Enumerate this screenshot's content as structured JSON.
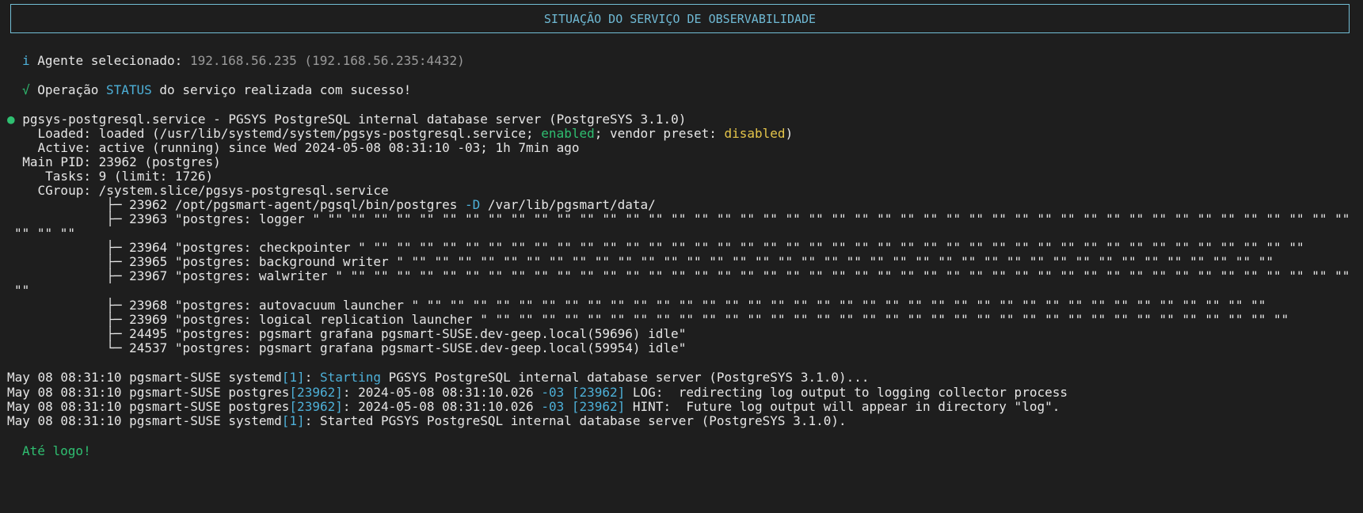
{
  "header": {
    "title": "SITUAÇÃO DO SERVIÇO DE OBSERVABILIDADE"
  },
  "agent": {
    "icon": "i",
    "label": "Agente selecionado: ",
    "value": "192.168.56.235 (192.168.56.235:4432)"
  },
  "operation": {
    "icon": "√",
    "prefix": "Operação ",
    "keyword": "STATUS",
    "suffix": " do serviço realizada com sucesso!"
  },
  "service": {
    "bullet": "●",
    "title": "pgsys-postgresql.service - PGSYS PostgreSQL internal database server (PostgreSYS 3.1.0)",
    "loaded_prefix": "    Loaded: loaded (/usr/lib/systemd/system/pgsys-postgresql.service; ",
    "loaded_enabled": "enabled",
    "loaded_mid": "; vendor preset: ",
    "loaded_disabled": "disabled",
    "loaded_suffix": ")",
    "active": "    Active: active (running) since Wed 2024-05-08 08:31:10 -03; 1h 7min ago",
    "main_pid": "  Main PID: 23962 (postgres)",
    "tasks": "     Tasks: 9 (limit: 1726)",
    "cgroup": "    CGroup: /system.slice/pgsys-postgresql.service",
    "proc1_prefix": "             ├─ 23962 /opt/pgsmart-agent/pgsql/bin/postgres ",
    "proc1_flag": "-D",
    "proc1_suffix": " /var/lib/pgsmart/data/",
    "proc2": "             ├─ 23963 \"postgres: logger \" \"\" \"\" \"\" \"\" \"\" \"\" \"\" \"\" \"\" \"\" \"\" \"\" \"\" \"\" \"\" \"\" \"\" \"\" \"\" \"\" \"\" \"\" \"\" \"\" \"\" \"\" \"\" \"\" \"\" \"\" \"\" \"\" \"\" \"\" \"\" \"\" \"\" \"\" \"\" \"\" \"\" \"\" \"\" \"\" \"\"",
    "proc2_wrap": "\"\" \"\" \"\"",
    "proc3": "             ├─ 23964 \"postgres: checkpointer \" \"\" \"\" \"\" \"\" \"\" \"\" \"\" \"\" \"\" \"\" \"\" \"\" \"\" \"\" \"\" \"\" \"\" \"\" \"\" \"\" \"\" \"\" \"\" \"\" \"\" \"\" \"\" \"\" \"\" \"\" \"\" \"\" \"\" \"\" \"\" \"\" \"\" \"\" \"\" \"\" \"\"",
    "proc4": "             ├─ 23965 \"postgres: background writer \" \"\" \"\" \"\" \"\" \"\" \"\" \"\" \"\" \"\" \"\" \"\" \"\" \"\" \"\" \"\" \"\" \"\" \"\" \"\" \"\" \"\" \"\" \"\" \"\" \"\" \"\" \"\" \"\" \"\" \"\" \"\" \"\" \"\" \"\" \"\" \"\" \"\" \"\"",
    "proc5": "             ├─ 23967 \"postgres: walwriter \" \"\" \"\" \"\" \"\" \"\" \"\" \"\" \"\" \"\" \"\" \"\" \"\" \"\" \"\" \"\" \"\" \"\" \"\" \"\" \"\" \"\" \"\" \"\" \"\" \"\" \"\" \"\" \"\" \"\" \"\" \"\" \"\" \"\" \"\" \"\" \"\" \"\" \"\" \"\" \"\" \"\" \"\" \"\" \"\"",
    "proc5_wrap": "\"\"",
    "proc6": "             ├─ 23968 \"postgres: autovacuum launcher \" \"\" \"\" \"\" \"\" \"\" \"\" \"\" \"\" \"\" \"\" \"\" \"\" \"\" \"\" \"\" \"\" \"\" \"\" \"\" \"\" \"\" \"\" \"\" \"\" \"\" \"\" \"\" \"\" \"\" \"\" \"\" \"\" \"\" \"\" \"\" \"\" \"\"",
    "proc7": "             ├─ 23969 \"postgres: logical replication launcher \" \"\" \"\" \"\" \"\" \"\" \"\" \"\" \"\" \"\" \"\" \"\" \"\" \"\" \"\" \"\" \"\" \"\" \"\" \"\" \"\" \"\" \"\" \"\" \"\" \"\" \"\" \"\" \"\" \"\" \"\" \"\" \"\" \"\" \"\" \"\"",
    "proc8": "             ├─ 24495 \"postgres: pgsmart grafana pgsmart-SUSE.dev-geep.local(59696) idle\"",
    "proc9": "             └─ 24537 \"postgres: pgsmart grafana pgsmart-SUSE.dev-geep.local(59954) idle\""
  },
  "logs": [
    {
      "prefix": "May 08 08:31:10 pgsmart-SUSE systemd",
      "pid": "[1]",
      "mid": ": ",
      "keyword": "Starting",
      "message": " PGSYS PostgreSQL internal database server (PostgreSYS 3.1.0)..."
    },
    {
      "prefix": "May 08 08:31:10 pgsmart-SUSE postgres",
      "pid": "[23962]",
      "mid": ": 2024-05-08 08:31:10.026 ",
      "tz": "-03",
      "pid2": " [23962]",
      "message": " LOG:  redirecting log output to logging collector process"
    },
    {
      "prefix": "May 08 08:31:10 pgsmart-SUSE postgres",
      "pid": "[23962]",
      "mid": ": 2024-05-08 08:31:10.026 ",
      "tz": "-03",
      "pid2": " [23962]",
      "message": " HINT:  Future log output will appear in directory \"log\"."
    },
    {
      "prefix": "May 08 08:31:10 pgsmart-SUSE systemd",
      "pid": "[1]",
      "message": ": Started PGSYS PostgreSQL internal database server (PostgreSYS 3.1.0)."
    }
  ],
  "goodbye": "Até logo!"
}
